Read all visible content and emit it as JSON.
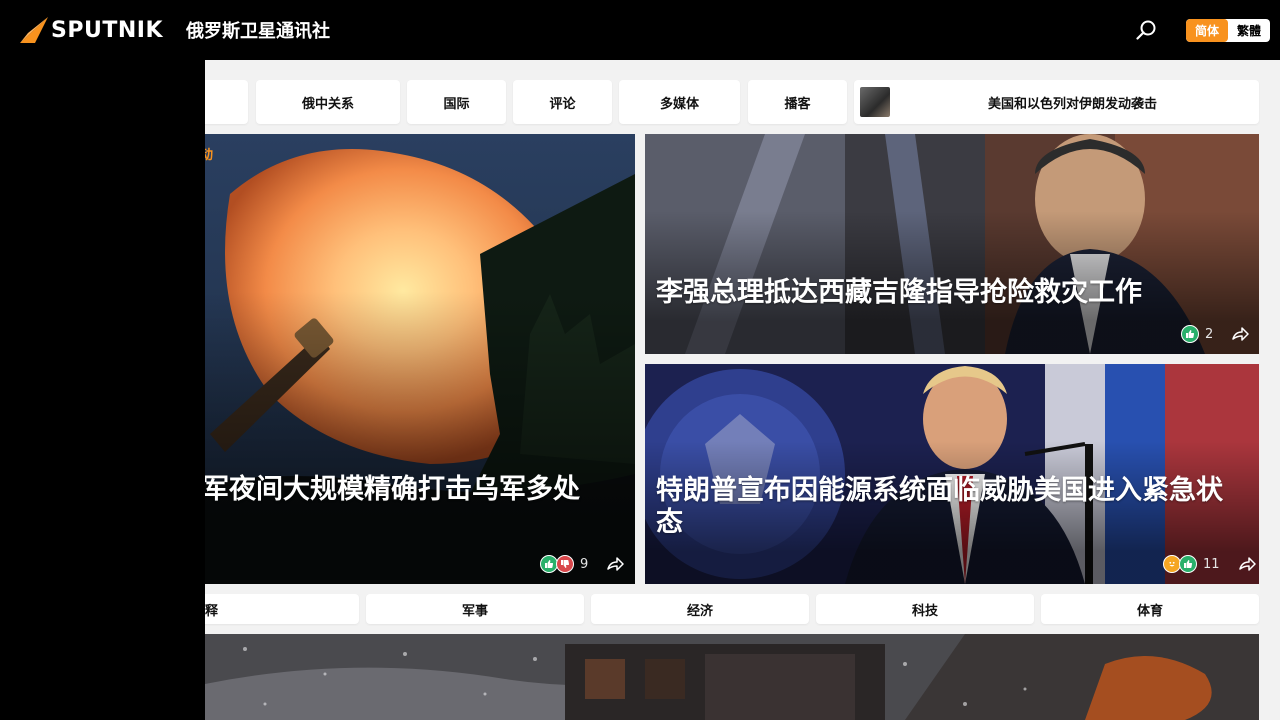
{
  "header": {
    "logo_text": "SPUTNIK",
    "site_name": "俄罗斯卫星通讯社",
    "lang_options": [
      "简体",
      "繁體"
    ],
    "lang_active": "简体",
    "accent_color": "#f8921e"
  },
  "nav": {
    "items": [
      "俄中关系",
      "国际",
      "评论",
      "多媒体",
      "播客"
    ],
    "partial_first_char": "",
    "featured_label": "美国和以色列对伊朗发动袭击"
  },
  "cards": {
    "main": {
      "tag_partial": "动",
      "title": "军夜间大规模精确打击乌军多处",
      "reactions": [
        "like",
        "dislike"
      ],
      "count": "9"
    },
    "top_right": {
      "title": "李强总理抵达西藏吉隆指导抢险救灾工作",
      "reactions": [
        "like"
      ],
      "count": "2"
    },
    "bottom_right": {
      "title": "特朗普宣布因能源系统面临威胁美国进入紧急状态",
      "reactions": [
        "laugh",
        "like"
      ],
      "count": "11"
    }
  },
  "categories": {
    "partial_first": "释",
    "items": [
      "军事",
      "经济",
      "科技",
      "体育"
    ]
  }
}
